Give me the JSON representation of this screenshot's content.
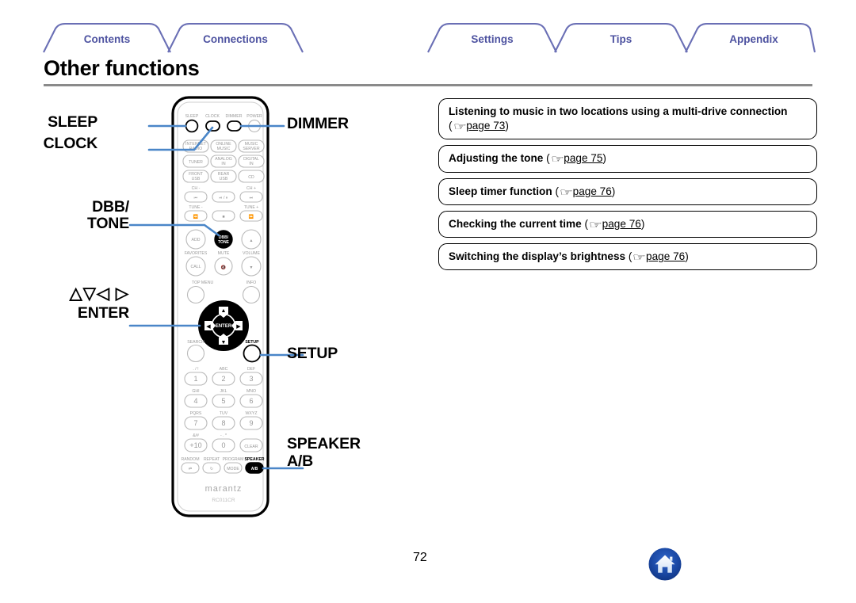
{
  "document": {
    "page_title": "Other functions",
    "page_number": "72"
  },
  "tabs": [
    {
      "label": "Contents",
      "name": "tab-contents"
    },
    {
      "label": "Connections",
      "name": "tab-connections"
    },
    {
      "label": "Settings",
      "name": "tab-settings"
    },
    {
      "label": "Tips",
      "name": "tab-tips"
    },
    {
      "label": "Appendix",
      "name": "tab-appendix"
    }
  ],
  "links": [
    {
      "title": "Listening to music in two locations using a multi-drive connection",
      "ref_open": "(",
      "hand_icon": "☞",
      "page_text": "page 73",
      "ref_close": ")"
    },
    {
      "title": "Adjusting the tone",
      "ref_open": "(",
      "hand_icon": "☞",
      "page_text": "page 75",
      "ref_close": ")"
    },
    {
      "title": "Sleep timer function",
      "ref_open": "(",
      "hand_icon": "☞",
      "page_text": "page 76",
      "ref_close": ")"
    },
    {
      "title": "Checking the current time",
      "ref_open": "(",
      "hand_icon": "☞",
      "page_text": "page 76",
      "ref_close": ")"
    },
    {
      "title": "Switching the display’s brightness",
      "ref_open": "(",
      "hand_icon": "☞",
      "page_text": "page 76",
      "ref_close": ")"
    }
  ],
  "callouts": {
    "sleep": "SLEEP",
    "clock": "CLOCK",
    "dbb_tone_line1": "DBB/",
    "dbb_tone_line2": "TONE",
    "cursor_arrows": "△▽◁ ▷",
    "enter": "ENTER",
    "dimmer": "DIMMER",
    "setup": "SETUP",
    "speaker_line1": "SPEAKER",
    "speaker_line2": "A/B"
  },
  "remote": {
    "brand": "marantz",
    "model": "RC011CR",
    "top_buttons": [
      "SLEEP",
      "CLOCK",
      "DIMMER",
      "POWER"
    ],
    "source_buttons": [
      "INTERNET RADIO",
      "ONLINE MUSIC",
      "MUSIC SERVER",
      "TUNER",
      "ANALOG IN",
      "DIGITAL IN",
      "FRONT USB",
      "REAR USB",
      "CD"
    ],
    "transport_labels": {
      "ch_minus": "CH -",
      "ch_plus": "CH +",
      "tune_minus": "TUNE -",
      "tune_plus": "TUNE +"
    },
    "mid_buttons": {
      "add": "ADD",
      "dbb_tone_line1": "DBB/",
      "dbb_tone_line2": "TONE",
      "favorites": "FAVORITES",
      "call": "CALL",
      "mute": "MUTE",
      "volume": "VOLUME",
      "top_menu": "TOP MENU",
      "info": "INFO",
      "search": "SEARCH",
      "setup": "SETUP",
      "enter": "ENTER"
    },
    "keypad": [
      {
        "key": "1",
        "sub": ". / !"
      },
      {
        "key": "2",
        "sub": "ABC"
      },
      {
        "key": "3",
        "sub": "DEF"
      },
      {
        "key": "4",
        "sub": "GHI"
      },
      {
        "key": "5",
        "sub": "JKL"
      },
      {
        "key": "6",
        "sub": "MNO"
      },
      {
        "key": "7",
        "sub": "PQRS"
      },
      {
        "key": "8",
        "sub": "TUV"
      },
      {
        "key": "9",
        "sub": "WXYZ"
      },
      {
        "key": "+10",
        "sub": "&/#"
      },
      {
        "key": "0",
        "sub": "- . *"
      },
      {
        "key": "CLEAR",
        "sub": ""
      }
    ],
    "bottom_row": [
      {
        "label": "RANDOM",
        "glyph": "⤨"
      },
      {
        "label": "REPEAT",
        "glyph": "↻"
      },
      {
        "label": "PROGRAM",
        "glyph": "MODE"
      },
      {
        "label": "SPEAKER",
        "glyph": "A/B"
      }
    ]
  },
  "colors": {
    "tab_text": "#4d52a0",
    "tab_stroke": "#6a6fb5",
    "rule": "#8a8a8a",
    "leader_line": "#4a86c8",
    "home_icon": "#1b49a5",
    "remote_body": "#ffffff",
    "remote_outline": "#000000",
    "highlight_fill": "#000000"
  },
  "footer": {
    "home_icon": "home-icon"
  }
}
